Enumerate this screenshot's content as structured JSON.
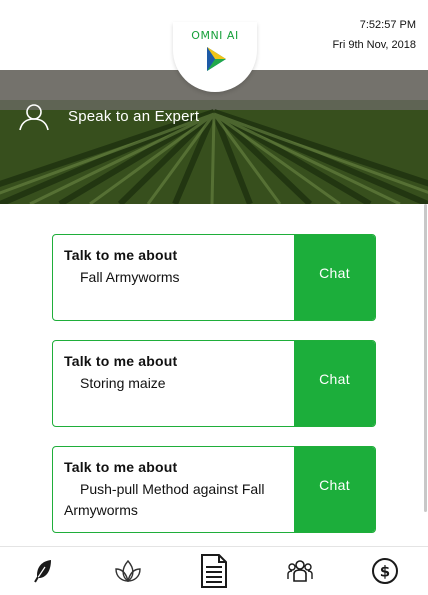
{
  "header": {
    "time": "7:52:57 PM",
    "date": "Fri 9th Nov, 2018",
    "brand": "OMNI AI"
  },
  "hero": {
    "label": "Speak to an Expert"
  },
  "cards": [
    {
      "title": "Talk to me about",
      "topic": "Fall Armyworms",
      "action": "Chat"
    },
    {
      "title": "Talk to me about",
      "topic": "Storing maize",
      "action": "Chat"
    },
    {
      "title": "Talk to me about",
      "topic": "Push-pull Method against Fall Armyworms",
      "action": "Chat"
    }
  ],
  "bottom_nav": [
    {
      "icon": "feather-icon"
    },
    {
      "icon": "leaf-icon"
    },
    {
      "icon": "document-icon"
    },
    {
      "icon": "group-icon"
    },
    {
      "icon": "dollar-icon"
    }
  ],
  "colors": {
    "accent": "#1cae3b",
    "card_border": "#1fae3a"
  }
}
